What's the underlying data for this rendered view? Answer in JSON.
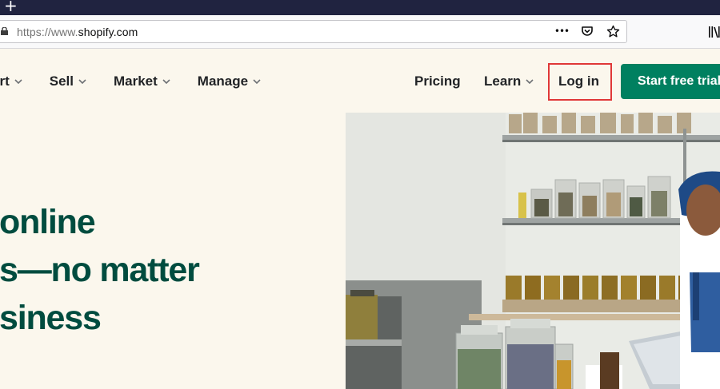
{
  "browser": {
    "new_tab_label": "+",
    "url_prefix": "https://www.",
    "url_domain": "shopify.com",
    "more_label": "•••"
  },
  "nav": {
    "left_items": [
      {
        "label": "art"
      },
      {
        "label": "Sell"
      },
      {
        "label": "Market"
      },
      {
        "label": "Manage"
      }
    ],
    "pricing": "Pricing",
    "learn": "Learn",
    "login": "Log in",
    "cta": "Start free trial"
  },
  "hero": {
    "line1": "online",
    "line2": "s—no matter",
    "line3": "siness"
  },
  "colors": {
    "brand_green": "#008060",
    "heading_green": "#004c3f",
    "page_bg": "#fbf7ed",
    "highlight_red": "#e03838"
  }
}
